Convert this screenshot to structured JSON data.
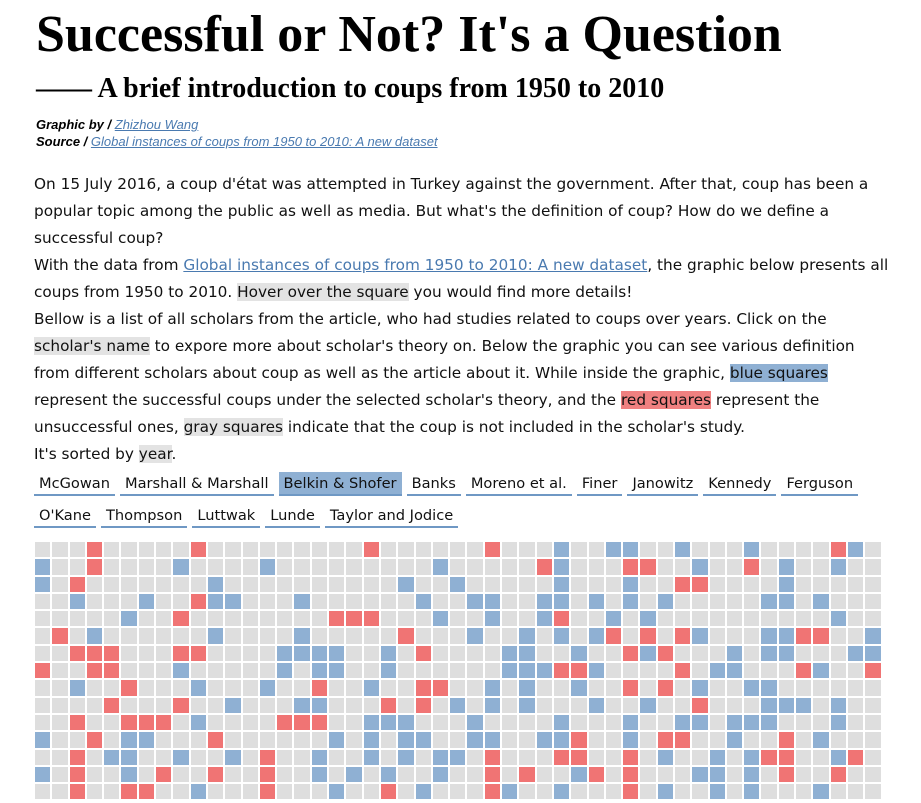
{
  "header": {
    "title": "Successful or Not? It's a Question",
    "subtitle": "—— A brief introduction to coups from 1950 to 2010"
  },
  "credits": {
    "graphic_label": "Graphic by / ",
    "graphic_author": "Zhizhou Wang",
    "source_label": "Source / ",
    "source_link": "Global instances of coups from 1950 to 2010: A new dataset"
  },
  "intro": {
    "p1": "On 15 July 2016, a coup d'état was attempted in Turkey against the government. After that, coup has been a popular topic among the public as well as media. But what's the definition of coup? How do we define a successful coup?",
    "p2_a": "With the data from ",
    "p2_link": "Global instances of coups from 1950 to 2010: A new dataset",
    "p2_b": ", the graphic below presents all coups from 1950 to 2010. ",
    "p2_hl": "Hover over the square",
    "p2_c": " you would find more details!",
    "p3_a": "Bellow is a list of all scholars from the article, who had studies related to coups over years. Click on the ",
    "p3_hl1": "scholar's name",
    "p3_b": " to expore more about scholar's theory on. Below the graphic you can see various definition from different scholars about coup as well as the article about it. While inside the graphic, ",
    "p3_hl2": "blue squares",
    "p3_c": " represent the successful coups under the selected scholar's theory, and the ",
    "p3_hl3": "red squares",
    "p3_d": " represent the unsuccessful ones, ",
    "p3_hl4": "gray squares",
    "p3_e": " indicate that the coup is not included in the scholar's study.",
    "p4_a": "It's sorted by ",
    "p4_hl": "year",
    "p4_b": "."
  },
  "scholars": {
    "row1": [
      "McGowan",
      "Marshall & Marshall",
      "Belkin & Shofer",
      "Banks",
      "Moreno et al.",
      "Finer",
      "Janowitz",
      "Kennedy",
      "Ferguson"
    ],
    "row2": [
      "O'Kane",
      "Thompson",
      "Luttwak",
      "Lunde",
      "Taylor and Jodice"
    ],
    "selected": "Belkin & Shofer"
  },
  "colors": {
    "successful": "#8fb0d3",
    "unsuccessful": "#f07474",
    "not_included": "#dedede",
    "link": "#4a7ab0"
  },
  "grid": {
    "columns": 49,
    "rows": 15,
    "cells": [
      "...r.....r.........r......r...b..bb..b...b....rb.",
      "b..r....b....b.........b.....rb...rr..b..r.b..b.",
      "b.r.......b..........b..b.....b...b..rr....b.....",
      "..b...b..rbb...b......b..bb..bb.b.b.b.....bb.b..",
      ".....b..r........rrr...b..b..br..b.b..........b.",
      ".r.b......b....b.....r...b..b.b.br.r.rb...bbrr..b",
      "..rrr...rr....bbbb..b.r....bb..b..rbr...b.bb...bb",
      "r..rr...b.....b.bb..b......bbbrrb....r.bb...rb..r",
      "..b..r...b...b..r..b..rr..b.b..b..r.r.b..bb.....",
      "....r...r..b...bb...r.r.b.b.b...b..b..r...bbb.b.",
      "..r..rrr.b....rrr..bbb...b....b...b..bb.bbb...b.",
      "b..r.bb...r......b.b.bb..bb..bbr..b.rr..b..r.b..",
      "..r.bb..b..b.r..b..b.b.bb.r...rr..r.b..b.brr..br",
      "b.r..b.r..r..r..b.b.b..b..r.r..br.r...bb.b.r..r.",
      "..r..rr..b...r...b..r.b...rb..b...r.b..b.b...b.."
    ]
  }
}
